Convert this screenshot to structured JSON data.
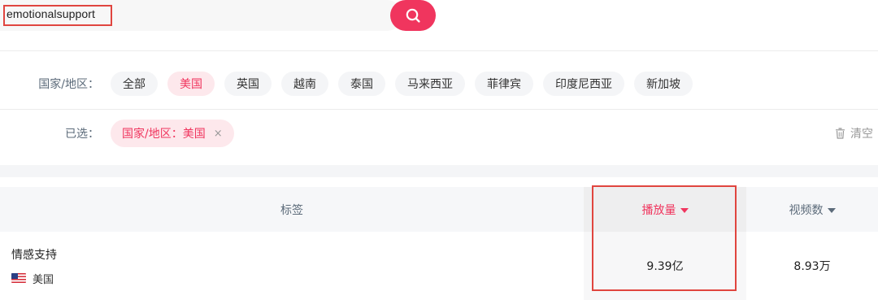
{
  "search": {
    "query": "emotionalsupport"
  },
  "filters": {
    "region_label": "国家/地区：",
    "regions": [
      "全部",
      "美国",
      "英国",
      "越南",
      "泰国",
      "马来西亚",
      "菲律宾",
      "印度尼西亚",
      "新加坡"
    ],
    "active_region": "美国",
    "selected_label": "已选：",
    "selected_chip": "国家/地区：美国",
    "selected_close": "×",
    "clear_label": "清空"
  },
  "table": {
    "headers": {
      "tag": "标签",
      "views": "播放量",
      "videos": "视频数"
    },
    "sorted_by": "views",
    "rows": [
      {
        "tag": "情感支持",
        "region": "美国",
        "views": "9.39亿",
        "videos": "8.93万"
      }
    ]
  },
  "colors": {
    "accent": "#f0355e",
    "accent_bg": "#fde8ec",
    "highlight_box": "#e0453f"
  }
}
